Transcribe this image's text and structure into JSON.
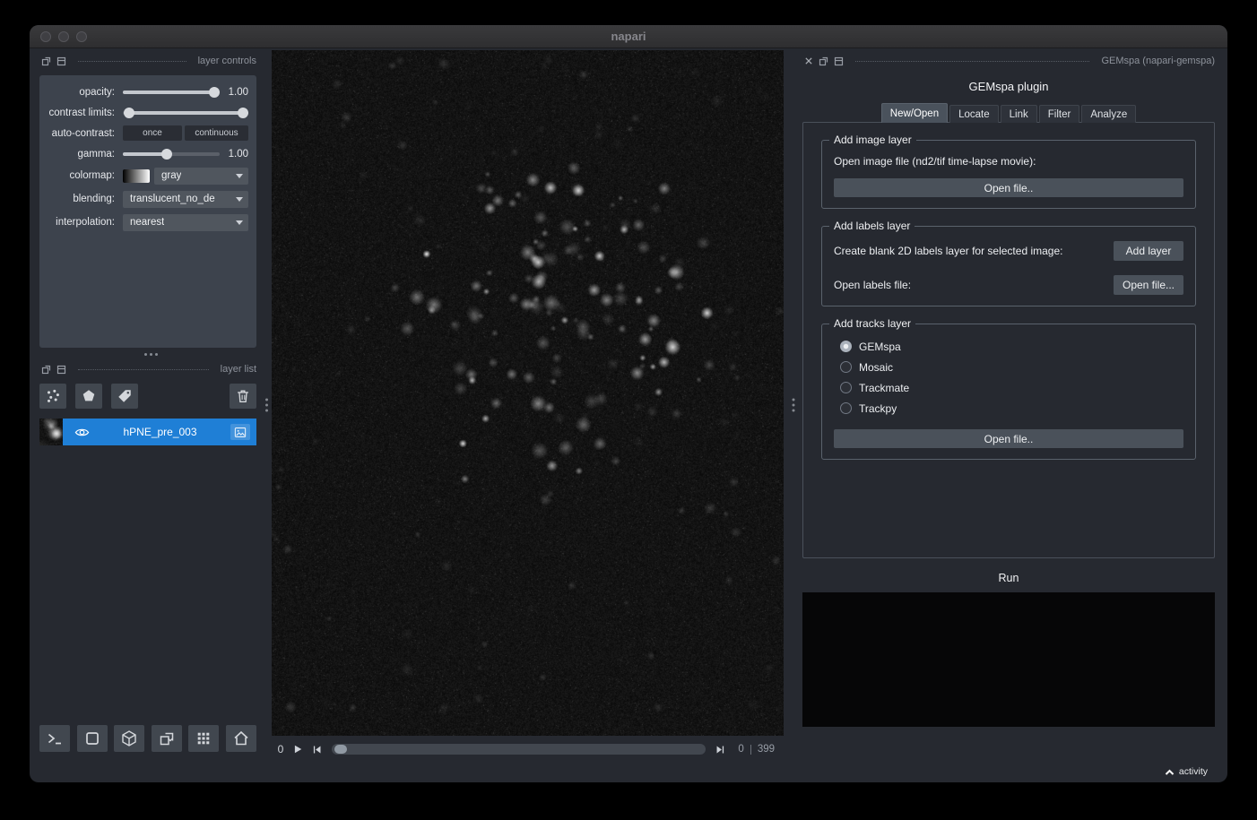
{
  "window": {
    "title": "napari"
  },
  "left_dock": {
    "layer_controls_title": "layer controls",
    "opacity_label": "opacity:",
    "opacity_value": "1.00",
    "contrast_label": "contrast limits:",
    "autocontrast_label": "auto-contrast:",
    "autocontrast_once": "once",
    "autocontrast_continuous": "continuous",
    "gamma_label": "gamma:",
    "gamma_value": "1.00",
    "colormap_label": "colormap:",
    "colormap_value": "gray",
    "blending_label": "blending:",
    "blending_value": "translucent_no_de",
    "interpolation_label": "interpolation:",
    "interpolation_value": "nearest",
    "layer_list_title": "layer list",
    "layers": [
      {
        "name": "hPNE_pre_003"
      }
    ]
  },
  "dims": {
    "frame": "0",
    "slider_current": "0",
    "slider_max": "399"
  },
  "plugin": {
    "dock_title": "GEMspa (napari-gemspa)",
    "title": "GEMspa plugin",
    "tabs": [
      "New/Open",
      "Locate",
      "Link",
      "Filter",
      "Analyze"
    ],
    "active_tab": "New/Open",
    "add_image_legend": "Add image layer",
    "add_image_prompt": "Open image file (nd2/tif time-lapse movie):",
    "add_image_button": "Open file..",
    "add_labels_legend": "Add labels layer",
    "add_labels_blank_prompt": "Create blank 2D labels layer for selected image:",
    "add_labels_add_button": "Add layer",
    "add_labels_open_prompt": "Open labels file:",
    "add_labels_open_button": "Open file...",
    "add_tracks_legend": "Add tracks layer",
    "track_options": [
      "GEMspa",
      "Mosaic",
      "Trackmate",
      "Trackpy"
    ],
    "selected_track_option": "GEMspa",
    "add_tracks_button": "Open file..",
    "run_label": "Run"
  },
  "status": {
    "activity_label": "activity"
  },
  "canvas_image": {
    "description": "grayscale fluorescence time-lapse frame with a central cluster of bright diffraction-limited particles on dark noisy background",
    "seed": 12,
    "spot_count": 120
  }
}
